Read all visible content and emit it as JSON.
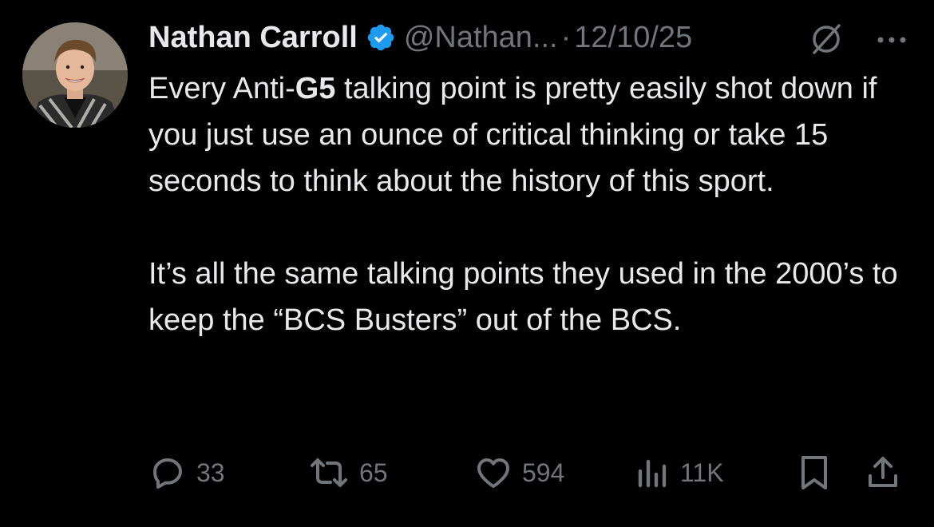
{
  "tweet": {
    "author": {
      "name": "Nathan Carroll",
      "handle": "@Nathan...",
      "verified": true,
      "avatar_icon": "profile-photo"
    },
    "separator": "·",
    "date": "12/10/25",
    "body": {
      "p1_before": "Every Anti-",
      "p1_bold": "G5",
      "p1_after": " talking point is pretty easily shot down if you just use an ounce of critical thinking or take 15 seconds to think about the history of this sport.",
      "p2": "It’s all the same talking points they used in the 2000’s to keep the “BCS Busters” out of the BCS."
    },
    "stats": {
      "replies": "33",
      "reposts": "65",
      "likes": "594",
      "views": "11K"
    }
  },
  "colors": {
    "background": "#000000",
    "text": "#e7e9ea",
    "muted": "#71767b",
    "verified_blue": "#1d9bf0"
  },
  "icons": {
    "verified": "verified-badge-icon",
    "grok": "grok-icon",
    "more": "more-icon",
    "reply": "reply-icon",
    "repost": "repost-icon",
    "like": "heart-icon",
    "views": "views-icon",
    "bookmark": "bookmark-icon",
    "share": "share-icon"
  }
}
